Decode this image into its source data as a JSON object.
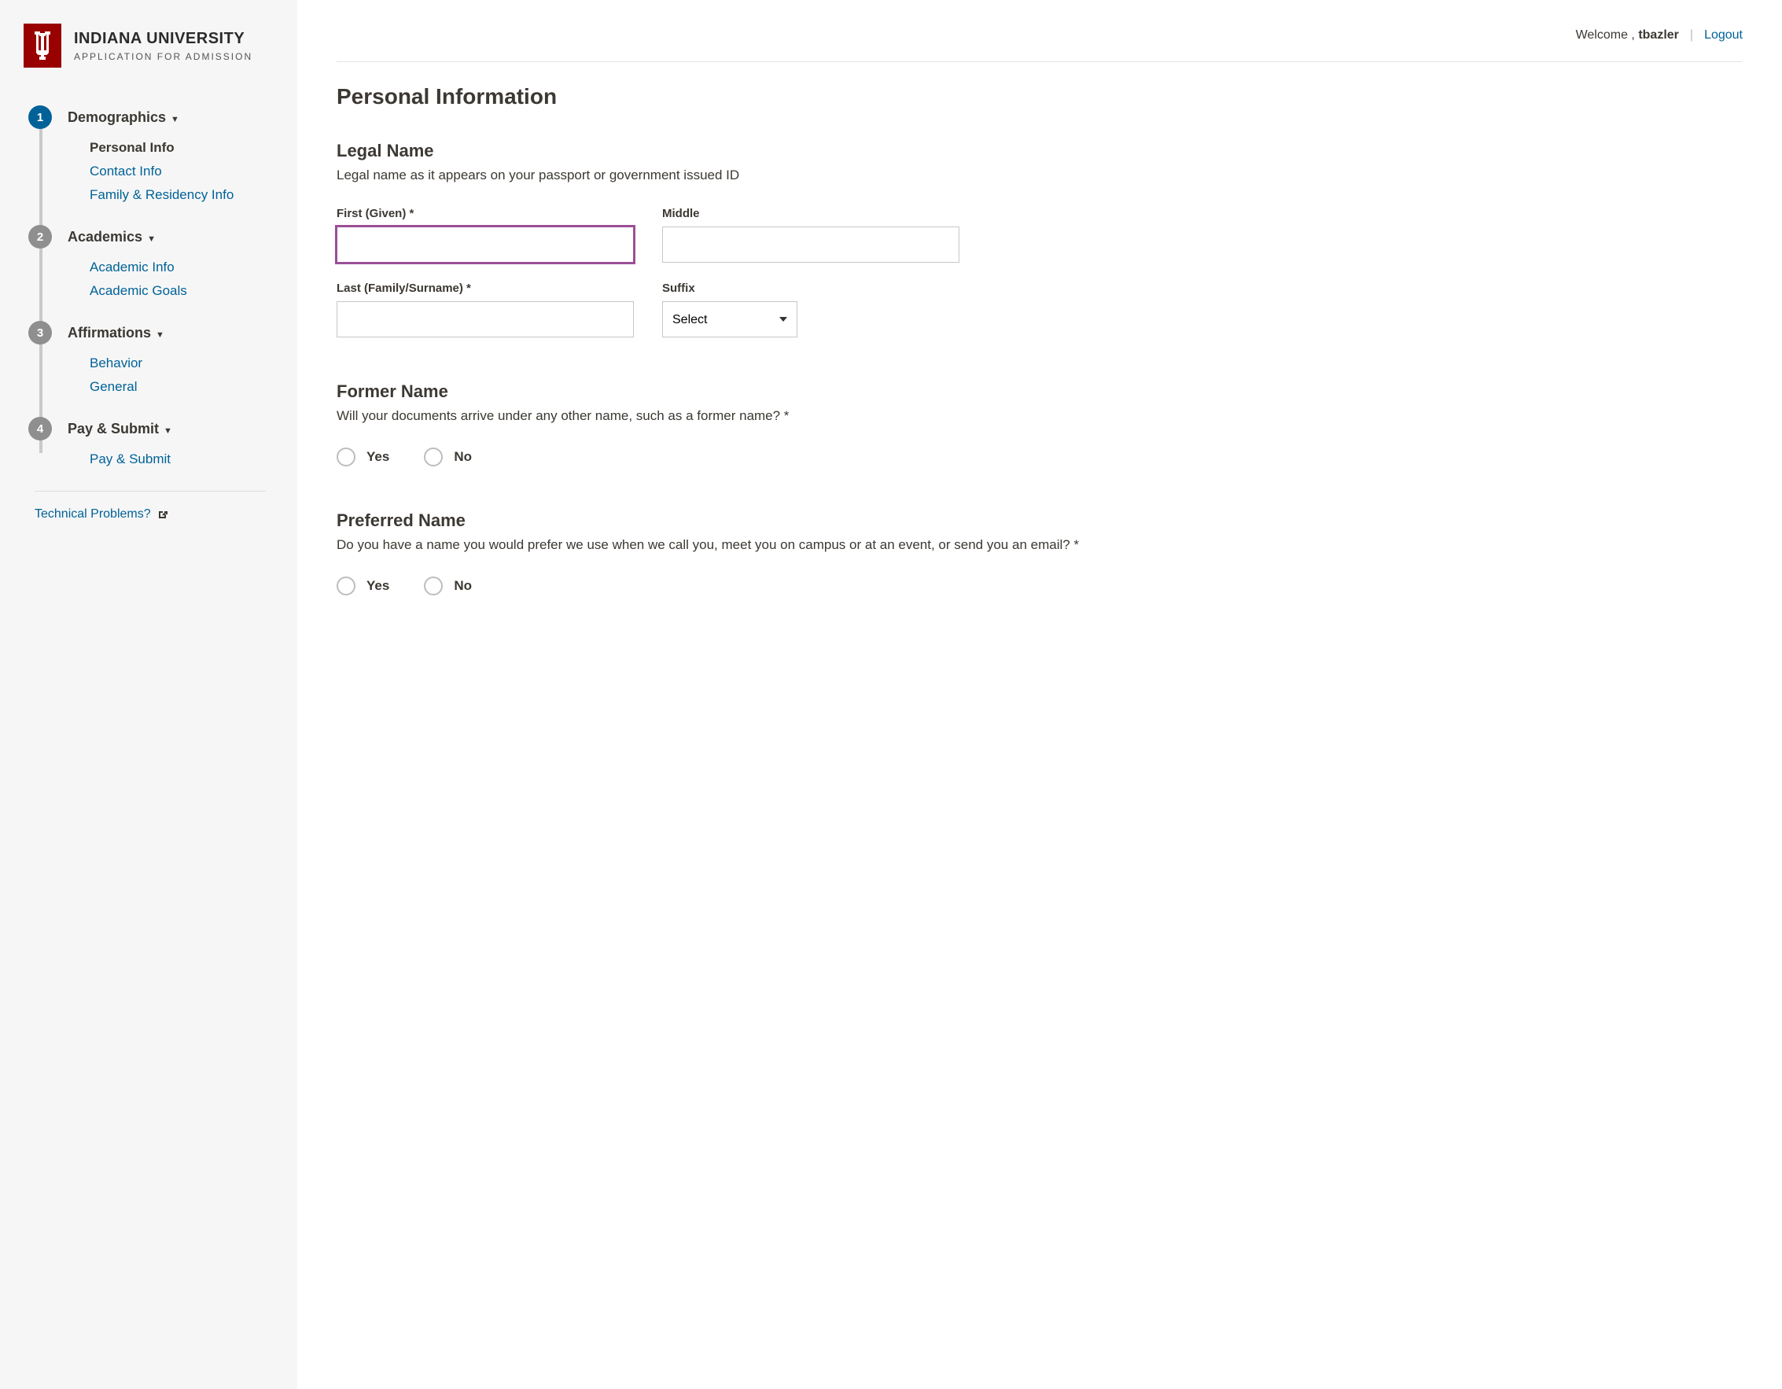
{
  "brand": {
    "title": "INDIANA UNIVERSITY",
    "subtitle": "APPLICATION FOR ADMISSION"
  },
  "sidebar": {
    "sections": [
      {
        "num": "1",
        "title": "Demographics",
        "active": true,
        "items": [
          {
            "label": "Personal Info",
            "current": true
          },
          {
            "label": "Contact Info",
            "current": false
          },
          {
            "label": "Family & Residency Info",
            "current": false
          }
        ]
      },
      {
        "num": "2",
        "title": "Academics",
        "active": false,
        "items": [
          {
            "label": "Academic Info",
            "current": false
          },
          {
            "label": "Academic Goals",
            "current": false
          }
        ]
      },
      {
        "num": "3",
        "title": "Affirmations",
        "active": false,
        "items": [
          {
            "label": "Behavior",
            "current": false
          },
          {
            "label": "General",
            "current": false
          }
        ]
      },
      {
        "num": "4",
        "title": "Pay & Submit",
        "active": false,
        "items": [
          {
            "label": "Pay & Submit",
            "current": false
          }
        ]
      }
    ],
    "tech_link": "Technical Problems?"
  },
  "topbar": {
    "welcome": "Welcome ,",
    "username": "tbazler",
    "logout": "Logout"
  },
  "page": {
    "title": "Personal Information"
  },
  "legal_name": {
    "heading": "Legal Name",
    "desc": "Legal name as it appears on your passport or government issued ID",
    "first_label": "First (Given) *",
    "middle_label": "Middle",
    "last_label": "Last (Family/Surname) *",
    "suffix_label": "Suffix",
    "suffix_selected": "Select"
  },
  "former_name": {
    "heading": "Former Name",
    "question": "Will your documents arrive under any other name, such as a former name? *",
    "yes": "Yes",
    "no": "No"
  },
  "preferred_name": {
    "heading": "Preferred Name",
    "question": "Do you have a name you would prefer we use when we call you, meet you on campus or at an event, or send you an email? *",
    "yes": "Yes",
    "no": "No"
  }
}
